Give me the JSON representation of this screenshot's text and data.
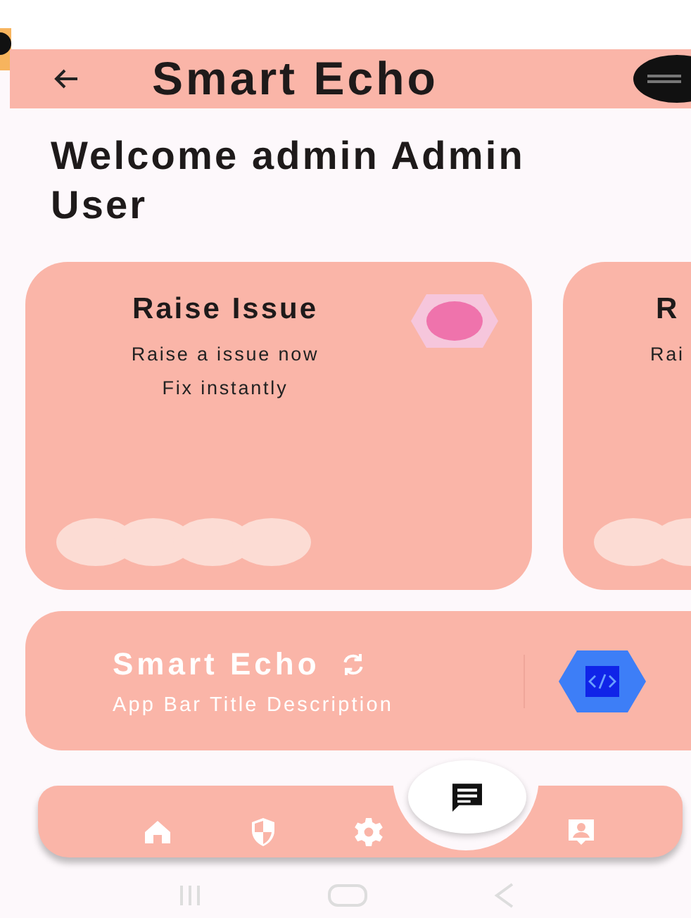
{
  "app_bar": {
    "title": "Smart Echo"
  },
  "welcome": "Welcome admin Admin User",
  "cards": [
    {
      "title": "Raise Issue",
      "lines": [
        "Raise a issue now",
        "Fix instantly"
      ]
    },
    {
      "title": "R",
      "lines": [
        "Rai"
      ]
    }
  ],
  "banner": {
    "title": "Smart Echo",
    "description": "App Bar Title Description"
  }
}
